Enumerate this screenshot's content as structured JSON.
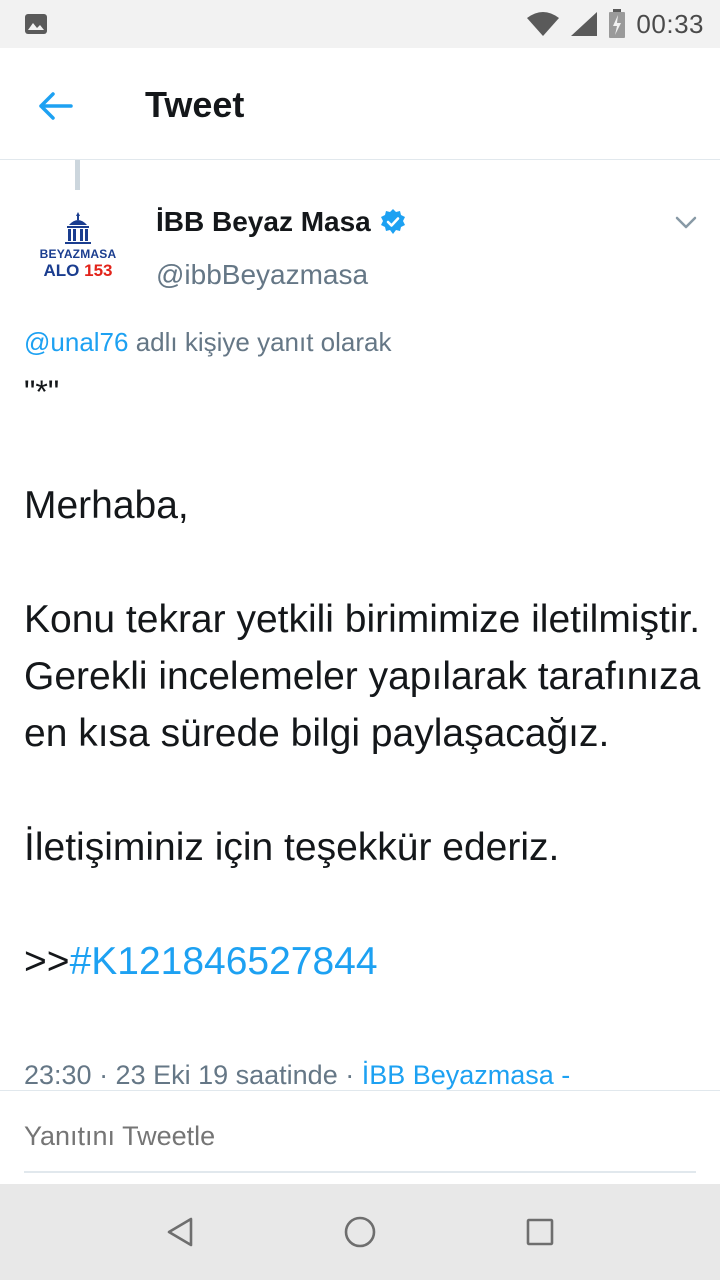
{
  "status_bar": {
    "time": "00:33",
    "icons": [
      "image-icon",
      "wifi-icon",
      "signal-icon",
      "battery-icon"
    ]
  },
  "app_bar": {
    "title": "Tweet",
    "back_icon": "arrow-left-icon"
  },
  "tweet": {
    "author": {
      "name": "İBB Beyaz Masa",
      "handle": "@ibbBeyazmasa",
      "verified": true,
      "avatar_text_line1": "BEYAZMASA",
      "avatar_text_line2_a": "ALO ",
      "avatar_text_line2_b": "153"
    },
    "reply_to_mention": "@unal76",
    "reply_to_suffix": " adlı kişiye yanıt olarak",
    "body": {
      "quote": "\"*\"",
      "line1": "Merhaba,",
      "para2": "Konu tekrar yetkili birimimize iletilmiştir. Gerekli incelemeler yapılarak tarafınıza en kısa sürede bilgi paylaşacağız.",
      "para3": "İletişiminiz için teşekkür ederiz.",
      "ref_prefix": ">>",
      "ref_hashtag": "#K121846527844"
    },
    "meta_time": "23:30 · 23 Eki 19 saatinde · ",
    "meta_source": "İBB Beyazmasa -"
  },
  "reply_box": {
    "placeholder": "Yanıtını Tweetle"
  },
  "nav_bar": {
    "back": "triangle-back-icon",
    "home": "circle-home-icon",
    "recents": "square-recents-icon"
  },
  "colors": {
    "accent": "#1da1f2",
    "text": "#14171a",
    "secondary": "#657786",
    "divider": "#e1e8ed"
  }
}
